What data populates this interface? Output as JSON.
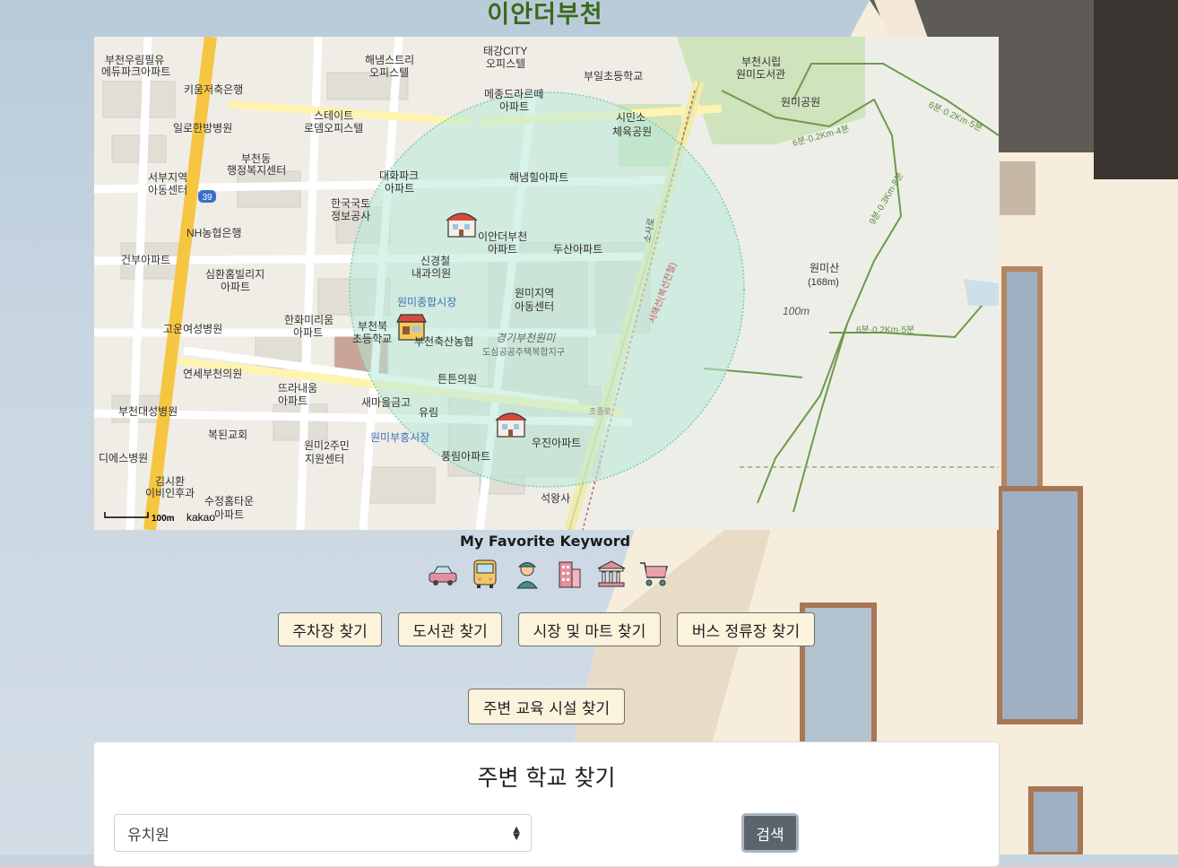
{
  "page": {
    "title": "이안더부천"
  },
  "map": {
    "attribution": "kakao",
    "scale_label": "100m",
    "road_number": "39",
    "labels": {
      "l01": "부천우림필유",
      "l02": "에듀파크아파트",
      "l03": "키움저축은행",
      "l04": "해냄스트리",
      "l05": "오피스텔",
      "l06": "태강CITY",
      "l07": "오피스텔",
      "l08": "부일초등학교",
      "l09": "부천시립",
      "l10": "원미도서관",
      "l11": "메종드라르떼",
      "l12": "아파트",
      "l13": "원미공원",
      "l14": "일로한방병원",
      "l15": "스테이트",
      "l16": "로뎀오피스텔",
      "l17": "시민소",
      "l18": "체육공원",
      "l19": "부천동",
      "l20": "행정복지센터",
      "l21": "서부지역",
      "l22": "아동센터",
      "l23": "대화파크",
      "l24": "아파트",
      "l25": "해냄힐아파트",
      "l26": "한국국토",
      "l27": "정보공사",
      "l28": "NH농협은행",
      "l29": "이안더부천",
      "l30": "아파트",
      "l31": "두산아파트",
      "l32": "신경철",
      "l33": "내과의원",
      "l34": "건부아파트",
      "l35": "심환홈빌리지",
      "l36": "아파트",
      "l37": "원미산",
      "l38": "(168m)",
      "l39": "원미지역",
      "l40": "아동센터",
      "l41": "원미종합시장",
      "l42": "한화미리움",
      "l43": "아파트",
      "l44": "부천북",
      "l45": "초등학교",
      "l46": "부천축산농협",
      "l47": "고운여성병원",
      "l48": "경기부천원미",
      "l49": "도심공공주택복합지구",
      "l50": "연세부천의원",
      "l51": "튼튼의원",
      "l52": "뜨라내움",
      "l53": "아파트",
      "l54": "새마을금고",
      "l55": "부천대성병원",
      "l56": "유림",
      "l57": "복된교회",
      "l58": "원미2주민",
      "l59": "지원센터",
      "l60": "원미부흥시장",
      "l61": "우진아파트",
      "l62": "디에스병원",
      "l63": "풍림아파트",
      "l64": "김시환",
      "l65": "이비인후과",
      "l66": "수정홈타운",
      "l67": "아파트",
      "l68": "석왕사",
      "l69": "100m",
      "l70": "소사로",
      "l71": "서해선(복선전철)",
      "l72": "6분·0.2Km·5분",
      "l73": "6분·0.2Km·4분",
      "l74": "9분·0.3Km·8분",
      "l75": "6분·0.2Km·5분",
      "l76": "조종로"
    }
  },
  "favorites": {
    "title": "My Favorite Keyword",
    "icons": [
      "car-icon",
      "bus-icon",
      "person-icon",
      "building-icon",
      "bank-icon",
      "shopping-cart-icon"
    ]
  },
  "buttons": {
    "parking": "주차장 찾기",
    "library": "도서관 찾기",
    "market": "시장 및 마트 찾기",
    "bus_stop": "버스 정류장 찾기",
    "education": "주변 교육 시설 찾기"
  },
  "school_search": {
    "title": "주변 학교 찾기",
    "selected_option": "유치원",
    "search_label": "검색"
  },
  "colors": {
    "title_green": "#3a6a1c",
    "button_bg": "#fbf3dc",
    "search_button": "#5b636b",
    "radius_fill": "#b8ead9",
    "road_yellow": "#f6c542"
  }
}
